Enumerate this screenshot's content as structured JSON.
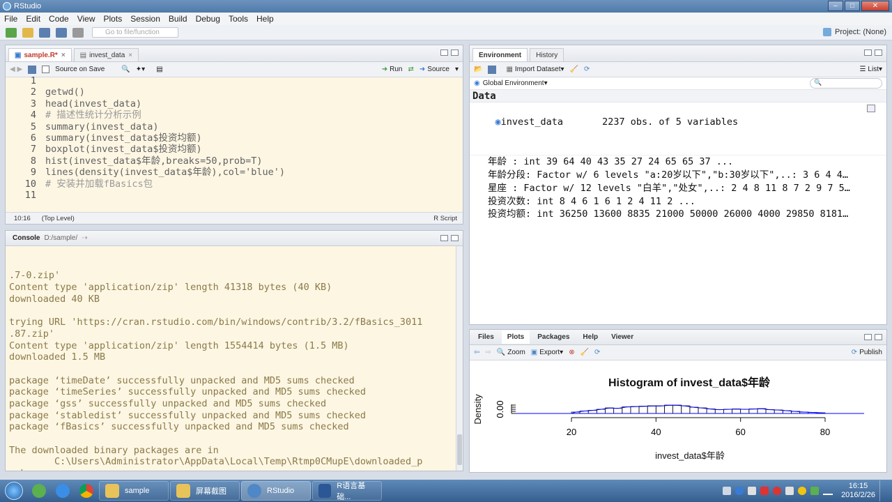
{
  "window": {
    "title": "RStudio"
  },
  "menu": [
    "File",
    "Edit",
    "Code",
    "View",
    "Plots",
    "Session",
    "Build",
    "Debug",
    "Tools",
    "Help"
  ],
  "toolbar": {
    "goto_placeholder": "Go to file/function",
    "project": "Project: (None)"
  },
  "editor": {
    "tabs": [
      "sample.R*",
      "invest_data"
    ],
    "source_on_save": "Source on Save",
    "run_label": "Run",
    "source_label": "Source",
    "lines": [
      "",
      "getwd()",
      "head(invest_data)",
      "# 描述性统计分析示例",
      "summary(invest_data)",
      "summary(invest_data$投资均额)",
      "boxplot(invest_data$投资均额)",
      "hist(invest_data$年龄,breaks=50,prob=T)",
      "lines(density(invest_data$年龄),col='blue')",
      "# 安装并加载fBasics包",
      ""
    ],
    "line_numbers": [
      "1",
      "2",
      "3",
      "4",
      "5",
      "6",
      "7",
      "8",
      "9",
      "10",
      "11"
    ],
    "status_pos": "10:16",
    "status_scope": "(Top Level)",
    "status_type": "R Script"
  },
  "console": {
    "title": "Console",
    "path": "D:/sample/",
    "lines": [
      ".7-0.zip'",
      "Content type 'application/zip' length 41318 bytes (40 KB)",
      "downloaded 40 KB",
      "",
      "trying URL 'https://cran.rstudio.com/bin/windows/contrib/3.2/fBasics_3011",
      ".87.zip'",
      "Content type 'application/zip' length 1554414 bytes (1.5 MB)",
      "downloaded 1.5 MB",
      "",
      "package ‘timeDate’ successfully unpacked and MD5 sums checked",
      "package ‘timeSeries’ successfully unpacked and MD5 sums checked",
      "package ‘gss’ successfully unpacked and MD5 sums checked",
      "package ‘stabledist’ successfully unpacked and MD5 sums checked",
      "package ‘fBasics’ successfully unpacked and MD5 sums checked",
      "",
      "The downloaded binary packages are in",
      "        C:\\Users\\Administrator\\AppData\\Local\\Temp\\Rtmp0CMupE\\downloaded_p",
      "ackages"
    ],
    "prompt": ">"
  },
  "environment": {
    "tabs": [
      "Environment",
      "History"
    ],
    "import_label": "Import Dataset",
    "list_label": "List",
    "scope_label": "Global Environment",
    "section": "Data",
    "object_name": "invest_data",
    "object_desc": "2237 obs. of 5 variables",
    "rows": [
      "年龄 : int 39 64 40 43 35 27 24 65 65 37 ...",
      "年龄分段: Factor w/ 6 levels \"a:20岁以下\",\"b:30岁以下\",..: 3 6 4 4…",
      "星座 : Factor w/ 12 levels \"白羊\",\"处女\",..: 2 4 8 11 8 7 2 9 7 5…",
      "投资次数: int 8 4 6 1 6 1 2 4 11 2 ...",
      "投资均额: int 36250 13600 8835 21000 50000 26000 4000 29850 8181…"
    ]
  },
  "plots": {
    "tabs": [
      "Files",
      "Plots",
      "Packages",
      "Help",
      "Viewer"
    ],
    "zoom_label": "Zoom",
    "export_label": "Export",
    "publish_label": "Publish"
  },
  "chart_data": {
    "type": "bar",
    "title": "Histogram of invest_data$年龄",
    "xlabel": "invest_data$年龄",
    "ylabel": "Density",
    "x_ticks": [
      "20",
      "40",
      "60",
      "80"
    ],
    "y_ticks": [
      "0.00"
    ],
    "xlim": [
      20,
      80
    ],
    "bin_edges": [
      20,
      22,
      24,
      26,
      28,
      30,
      32,
      34,
      36,
      38,
      40,
      42,
      44,
      46,
      48,
      50,
      52,
      54,
      56,
      58,
      60,
      62,
      64,
      66,
      68,
      70,
      72,
      74,
      76,
      78,
      80
    ],
    "density": [
      0.004,
      0.007,
      0.009,
      0.012,
      0.016,
      0.015,
      0.019,
      0.02,
      0.021,
      0.022,
      0.022,
      0.024,
      0.024,
      0.022,
      0.018,
      0.016,
      0.013,
      0.011,
      0.012,
      0.013,
      0.012,
      0.013,
      0.014,
      0.011,
      0.01,
      0.008,
      0.006,
      0.004,
      0.003,
      0.002
    ],
    "density_line_color": "#0000ff"
  },
  "taskbar": {
    "apps": [
      "sample",
      "屏幕截图",
      "RStudio",
      "R语言基础..."
    ],
    "time": "16:15",
    "date": "2016/2/26"
  }
}
